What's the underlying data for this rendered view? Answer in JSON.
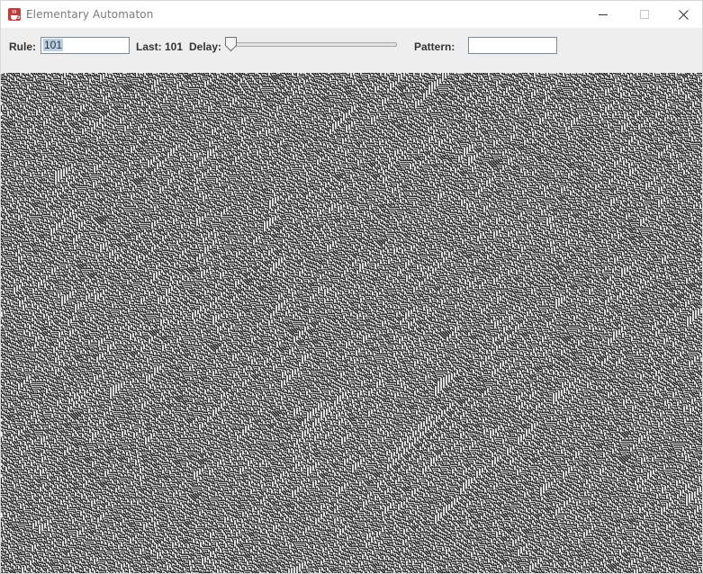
{
  "window": {
    "title": "Elementary Automaton",
    "app_icon": "java-cup-icon",
    "controls": [
      "minimize-icon",
      "maximize-icon",
      "close-icon"
    ]
  },
  "toolbar": {
    "rule_label": "Rule:",
    "rule_value": "101",
    "last_label": "Last: 101",
    "delay_label": "Delay:",
    "delay_value": 0,
    "pattern_label": "Pattern:",
    "pattern_value": ""
  },
  "automaton": {
    "rule": 101,
    "cell_color": "#000000",
    "background_color": "#ffffff"
  }
}
